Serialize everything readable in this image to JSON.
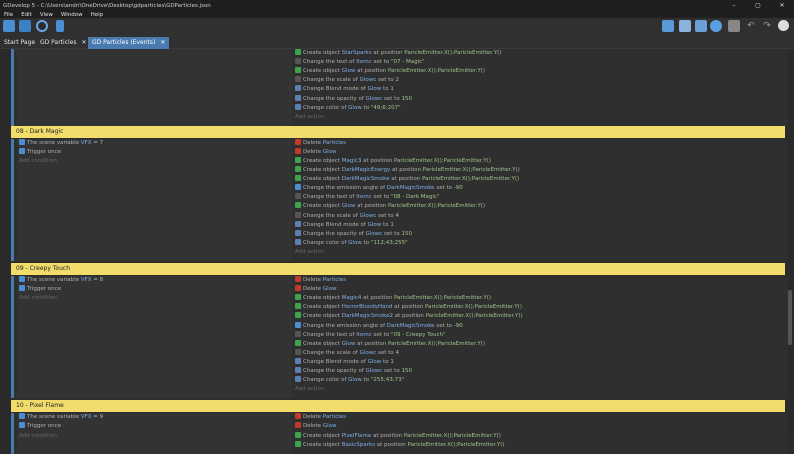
{
  "window": {
    "title": "GDevelop 5 - C:\\Users\\andri\\OneDrive\\Desktop\\gdparticles\\GDParticles.json",
    "minimize": "–",
    "maximize": "▢",
    "close": "✕"
  },
  "menu": [
    "File",
    "Edit",
    "View",
    "Window",
    "Help"
  ],
  "tabs": [
    {
      "label": "Start Page"
    },
    {
      "label": "GD Particles",
      "close": "✕"
    },
    {
      "label": "GD Particles (Events)",
      "close": "✕"
    }
  ],
  "colors": {
    "accent": "#4a7bb0",
    "header": "#f2dc6b",
    "object": "#7fb0e6",
    "argument": "#9fc58c",
    "string": "#c8b07a"
  },
  "top_block": {
    "actions": [
      [
        "Create object ",
        "StarSparks",
        " at position ",
        "ParicleEmitter.X();ParicleEmitter.Y()"
      ],
      [
        "Change the text of ",
        "Itemc",
        " set to ",
        "\"07 - Magic\""
      ],
      [
        "Create object ",
        "Glow",
        " at position ",
        "ParicleEmitter.X();ParicleEmitter.Y()"
      ],
      [
        "Change the scale of ",
        "Glowc",
        " set to ",
        "2"
      ],
      [
        "Change Blend mode of ",
        "Glow",
        " to ",
        "1"
      ],
      [
        "Change the opacity of ",
        "Glowc",
        " set to ",
        "150"
      ],
      [
        "Change color of ",
        "Glow",
        " to ",
        "\"49;6;207\""
      ]
    ],
    "add_action": "Add action"
  },
  "blocks": [
    {
      "header": "08 - Dark Magic",
      "conditions": [
        [
          "The scene variable ",
          "VFX",
          " = ",
          "7"
        ],
        [
          "Trigger once",
          "",
          "",
          ""
        ]
      ],
      "add_condition": "Add condition",
      "actions": [
        [
          "Delete ",
          "Particles",
          "",
          ""
        ],
        [
          "Delete ",
          "Glow",
          "",
          ""
        ],
        [
          "Create object ",
          "Magic3",
          " at position ",
          "ParicleEmitter.X();ParicleEmitter.Y()"
        ],
        [
          "Create object ",
          "DarkMagicEnergy",
          " at position ",
          "ParicleEmitter.X();ParicleEmitter.Y()"
        ],
        [
          "Create object ",
          "DarkMagicSmoke",
          " at position ",
          "ParicleEmitter.X();ParicleEmitter.Y()"
        ],
        [
          "Change the emission angle of ",
          "DarkMagicSmoke",
          " set to ",
          "-90"
        ],
        [
          "Change the text of ",
          "Itemc",
          " set to ",
          "\"08 - Dark Magic\""
        ],
        [
          "Create object ",
          "Glow",
          " at position ",
          "ParicleEmitter.X();ParicleEmitter.Y()"
        ],
        [
          "Change the scale of ",
          "Glowc",
          " set to ",
          "4"
        ],
        [
          "Change Blend mode of ",
          "Glow",
          " to ",
          "1"
        ],
        [
          "Change the opacity of ",
          "Glowc",
          " set to ",
          "150"
        ],
        [
          "Change color of ",
          "Glow",
          " to ",
          "\"112;43;255\""
        ]
      ],
      "add_action": "Add action"
    },
    {
      "header": "09 - Creepy Touch",
      "conditions": [
        [
          "The scene variable ",
          "VFX",
          " = ",
          "8"
        ],
        [
          "Trigger once",
          "",
          "",
          ""
        ]
      ],
      "add_condition": "Add condition",
      "actions": [
        [
          "Delete ",
          "Particles",
          "",
          ""
        ],
        [
          "Delete ",
          "Glow",
          "",
          ""
        ],
        [
          "Create object ",
          "Magic4",
          " at position ",
          "ParicleEmitter.X();ParicleEmitter.Y()"
        ],
        [
          "Create object ",
          "HorrorBloodyHand",
          " at position ",
          "ParicleEmitter.X();ParicleEmitter.Y()"
        ],
        [
          "Create object ",
          "DarkMagicSmoke2",
          " at position ",
          "ParicleEmitter.X();ParicleEmitter.Y()"
        ],
        [
          "Change the emission angle of ",
          "DarkMagicSmoke",
          " set to ",
          "-90"
        ],
        [
          "Change the text of ",
          "Itemc",
          " set to ",
          "\"09 - Creepy Touch\""
        ],
        [
          "Create object ",
          "Glow",
          " at position ",
          "ParicleEmitter.X();ParicleEmitter.Y()"
        ],
        [
          "Change the scale of ",
          "Glowc",
          " set to ",
          "4"
        ],
        [
          "Change Blend mode of ",
          "Glow",
          " to ",
          "1"
        ],
        [
          "Change the opacity of ",
          "Glowc",
          " set to ",
          "150"
        ],
        [
          "Change color of ",
          "Glow",
          " to ",
          "\"255;43;73\""
        ]
      ],
      "add_action": "Add action"
    },
    {
      "header": "10 - Pixel Flame",
      "conditions": [
        [
          "The scene variable ",
          "VFX",
          " = ",
          "9"
        ],
        [
          "Trigger once",
          "",
          "",
          ""
        ]
      ],
      "add_condition": "Add condition",
      "actions": [
        [
          "Delete ",
          "Particles",
          "",
          ""
        ],
        [
          "Delete ",
          "Glow",
          "",
          ""
        ],
        [
          "Create object ",
          "PixelFlame",
          " at position ",
          "ParicleEmitter.X();ParicleEmitter.Y()"
        ],
        [
          "Create object ",
          "BasicSparks",
          " at position ",
          "ParicleEmitter.X();ParicleEmitter.Y()"
        ]
      ],
      "add_action": ""
    }
  ]
}
